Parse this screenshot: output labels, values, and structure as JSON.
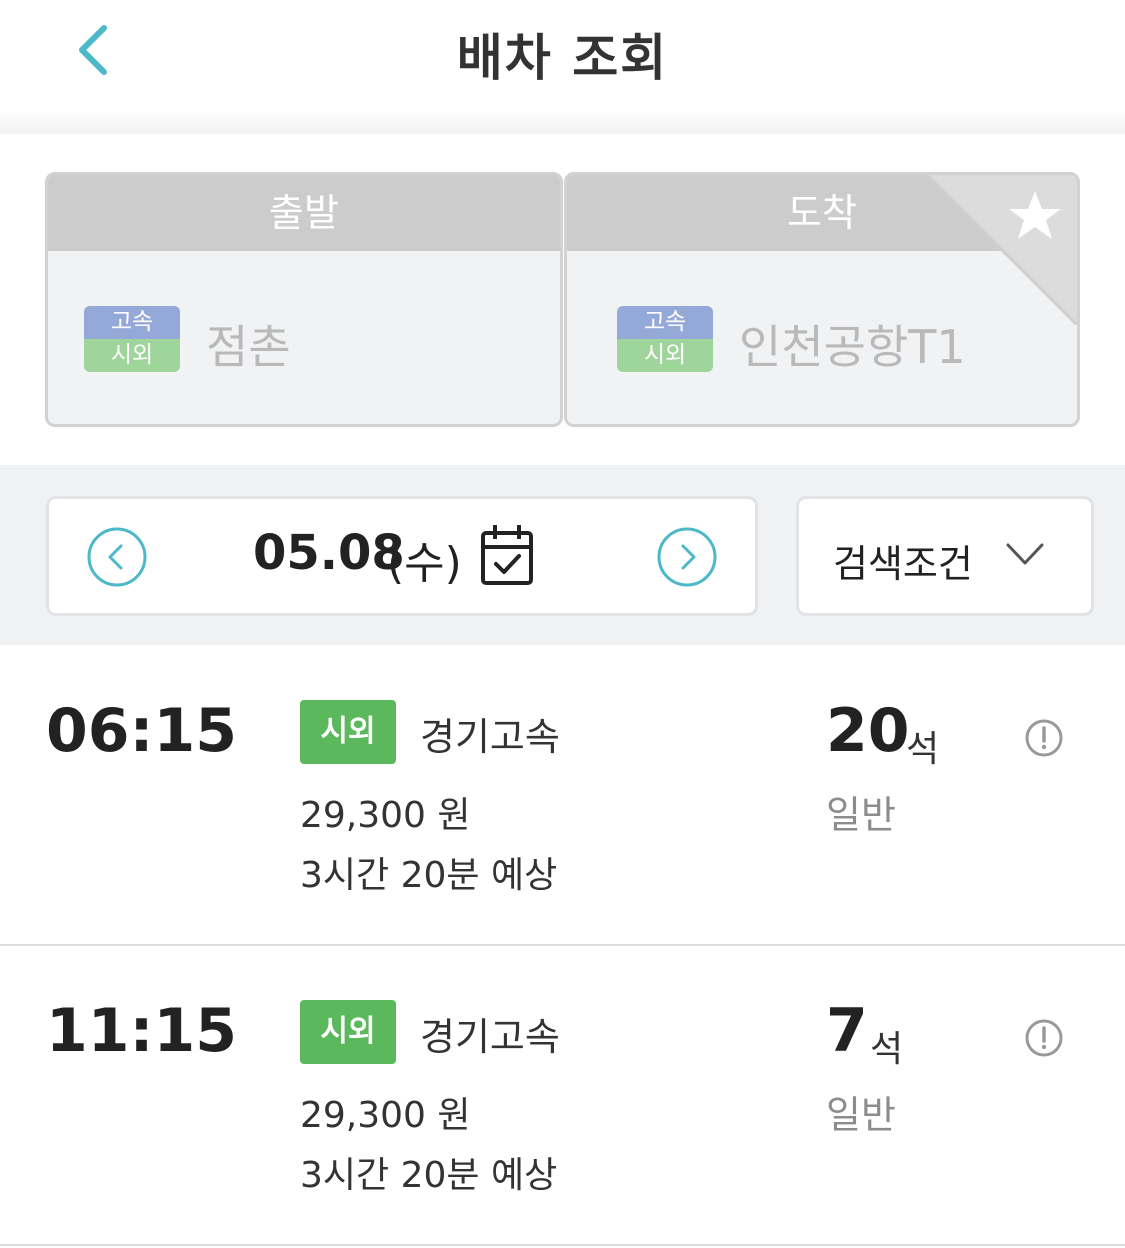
{
  "header": {
    "title": "배차 조회"
  },
  "route": {
    "departure": {
      "header": "출발",
      "badge_top": "고속",
      "badge_bottom": "시외",
      "terminal": "점촌"
    },
    "arrival": {
      "header": "도착",
      "badge_top": "고속",
      "badge_bottom": "시외",
      "terminal": "인천공항T1"
    }
  },
  "filter": {
    "date": "05.08",
    "day": "(수)",
    "condition_label": "검색조건"
  },
  "schedules": [
    {
      "time": "06:15",
      "type": "시외",
      "company": "경기고속",
      "fare": "29,300 원",
      "duration": "3시간 20분 예상",
      "seats": "20",
      "seats_unit": "석",
      "grade": "일반"
    },
    {
      "time": "11:15",
      "type": "시외",
      "company": "경기고속",
      "fare": "29,300 원",
      "duration": "3시간 20분 예상",
      "seats": "7",
      "seats_unit": "석",
      "grade": "일반"
    }
  ],
  "colors": {
    "accent": "#4cb8c8",
    "badge_express": "#95a9d9",
    "badge_intercity": "#9fd49a",
    "type_badge": "#5cb85c",
    "card_header": "#cccccc"
  },
  "icons": {
    "back": "chevron-left-icon",
    "favorite": "star-icon",
    "prev_date": "circle-chevron-left-icon",
    "next_date": "circle-chevron-right-icon",
    "calendar": "calendar-check-icon",
    "dropdown": "chevron-down-icon",
    "info": "info-exclamation-icon"
  }
}
